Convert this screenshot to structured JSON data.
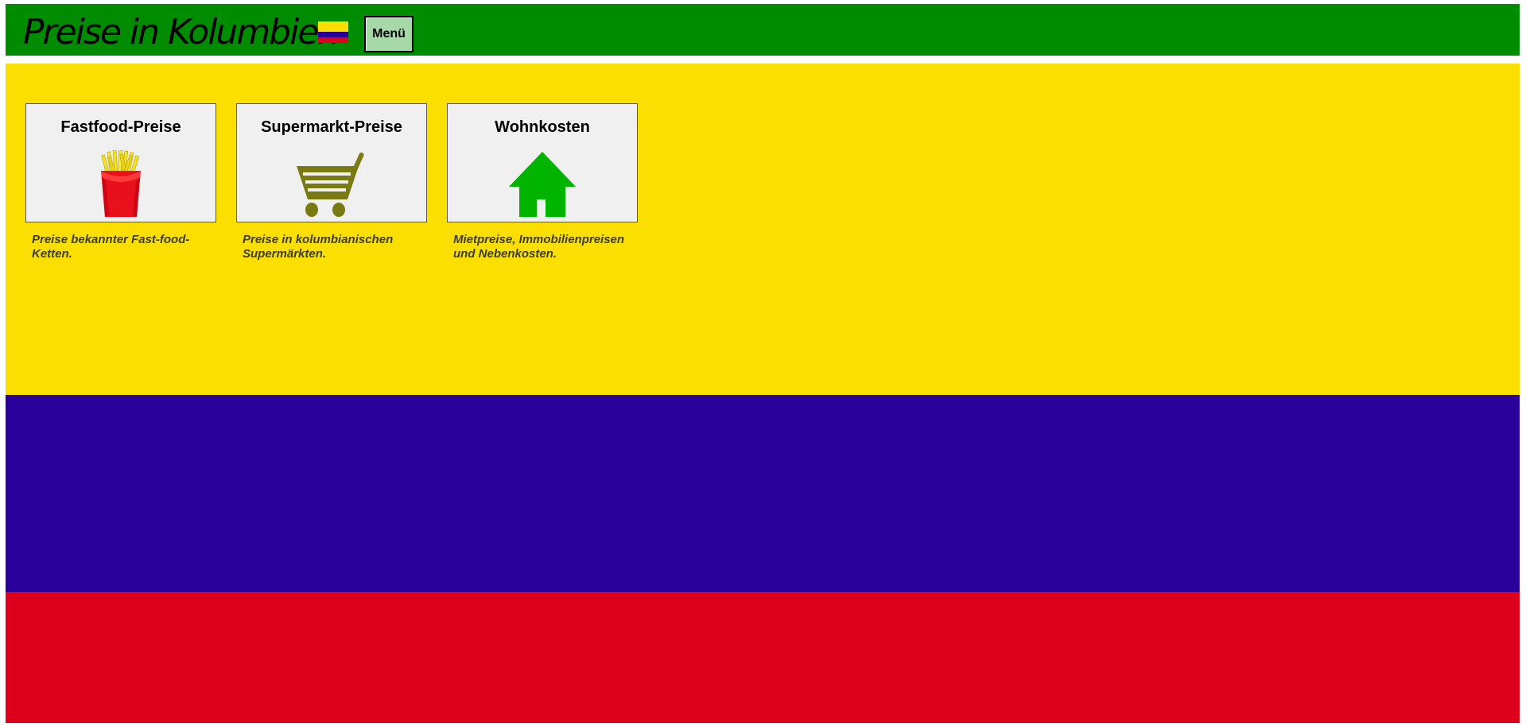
{
  "header": {
    "title": "Preise in Kolumbien",
    "flag_icon": "colombia-flag-icon",
    "menu_label": "Menü"
  },
  "colors": {
    "header_green": "#008c00",
    "flag_yellow": "#fadf00",
    "flag_blue": "#290099",
    "flag_red": "#dc001c",
    "card_background": "#f0f0f0"
  },
  "cards": [
    {
      "title": "Fastfood-Preise",
      "icon": "french-fries-icon",
      "description": "Preise bekannter Fast-food-Ketten."
    },
    {
      "title": "Supermarkt-Preise",
      "icon": "shopping-cart-icon",
      "description": "Preise in kolumbianischen Supermärkten."
    },
    {
      "title": "Wohnkosten",
      "icon": "house-icon",
      "description": "Mietpreise, Immobilienpreisen und Nebenkosten."
    }
  ]
}
